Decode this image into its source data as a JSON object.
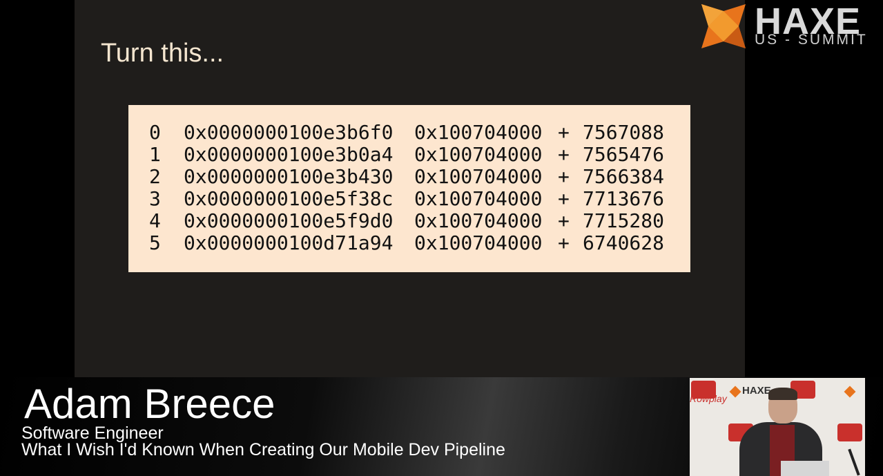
{
  "slide": {
    "title": "Turn this...",
    "rows": [
      {
        "index": "0",
        "address": "0x0000000100e3b6f0",
        "base": "0x100704000",
        "plus": "+",
        "offset": "7567088"
      },
      {
        "index": "1",
        "address": "0x0000000100e3b0a4",
        "base": "0x100704000",
        "plus": "+",
        "offset": "7565476"
      },
      {
        "index": "2",
        "address": "0x0000000100e3b430",
        "base": "0x100704000",
        "plus": "+",
        "offset": "7566384"
      },
      {
        "index": "3",
        "address": "0x0000000100e5f38c",
        "base": "0x100704000",
        "plus": "+",
        "offset": "7713676"
      },
      {
        "index": "4",
        "address": "0x0000000100e5f9d0",
        "base": "0x100704000",
        "plus": "+",
        "offset": "7715280"
      },
      {
        "index": "5",
        "address": "0x0000000100d71a94",
        "base": "0x100704000",
        "plus": "+",
        "offset": "6740628"
      }
    ]
  },
  "logo": {
    "word": "HAXE",
    "sub": "US - SUMMIT"
  },
  "lower_third": {
    "name": "Adam Breece",
    "role": "Software Engineer",
    "talk": "What I Wish I'd Known When Creating Our Mobile Dev Pipeline"
  },
  "video": {
    "backdrop_haxe": "HAXE",
    "backdrop_sponsor": "Rowplay"
  },
  "colors": {
    "slide_bg": "#1f1d1b",
    "code_bg": "#fde6cf",
    "title": "#f5e6d0",
    "logo_orange": "#e8741c"
  }
}
